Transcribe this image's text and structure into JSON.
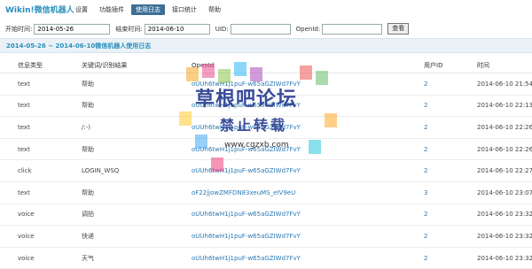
{
  "header": {
    "brand": "Wikin!微信机器人",
    "nav": [
      {
        "label": "设置",
        "active": false
      },
      {
        "label": "功能插件",
        "active": false
      },
      {
        "label": "使用日志",
        "active": true
      },
      {
        "label": "接口统计",
        "active": false
      },
      {
        "label": "帮助",
        "active": false
      }
    ]
  },
  "filters": {
    "start_label": "开始时间:",
    "start_value": "2014-05-26",
    "end_label": "结束时间:",
    "end_value": "2014-06-10",
    "uid_label": "UID:",
    "uid_value": "",
    "openid_label": "OpenId:",
    "openid_value": "",
    "submit_label": "查看"
  },
  "caption": "2014-05-26 ~ 2014-06-10微信机器人使用日志",
  "table": {
    "headers": [
      "信息类型",
      "关键词/识别结果",
      "OpenId",
      "用户ID",
      "时间"
    ],
    "rows": [
      [
        "text",
        "帮助",
        "oUUh6twH1j1puF-w65aGZIWd7FvY",
        "2",
        "2014-06-10 21:54"
      ],
      [
        "text",
        "帮助",
        "oUUh6twH1j1puF-w65aGZIWd7FvY",
        "2",
        "2014-06-10 22:13"
      ],
      [
        "text",
        "/:-)",
        "oUUh6twH1j1puF-w65aGZIWd7FvY",
        "2",
        "2014-06-10 22:26"
      ],
      [
        "text",
        "帮助",
        "oUUh6twH1j1puF-w65aGZIWd7FvY",
        "2",
        "2014-06-10 22:26"
      ],
      [
        "click",
        "LOGIN_WSQ",
        "oUUh6twH1j1puF-w65aGZIWd7FvY",
        "2",
        "2014-06-10 22:27"
      ],
      [
        "text",
        "帮助",
        "oF22jjowZMFDN83xeuMS_eIV9eU",
        "3",
        "2014-06-10 23:07"
      ],
      [
        "voice",
        "调拍",
        "oUUh6twH1j1puF-w65aGZIWd7FvY",
        "2",
        "2014-06-10 23:32"
      ],
      [
        "voice",
        "快递",
        "oUUh6twH1j1puF-w65aGZIWd7FvY",
        "2",
        "2014-06-10 23:32"
      ],
      [
        "voice",
        "天气",
        "oUUh6twH1j1puF-w65aGZIWd7FvY",
        "2",
        "2014-06-10 23:32"
      ]
    ]
  },
  "watermark": {
    "title": "草根吧论坛",
    "subtitle": "禁止转载",
    "url": "www.cgzxb.com"
  }
}
